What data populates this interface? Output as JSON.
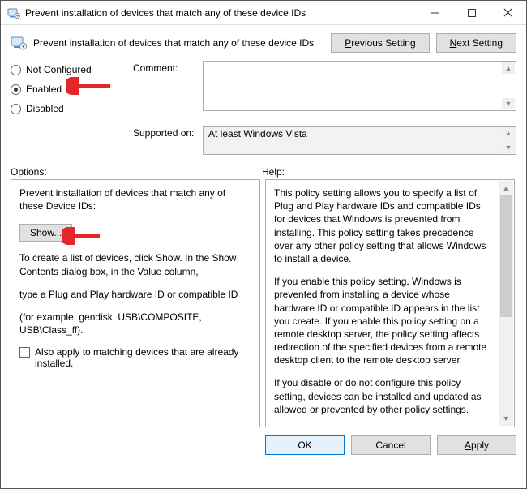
{
  "window": {
    "title": "Prevent installation of devices that match any of these device IDs"
  },
  "header": {
    "title": "Prevent installation of devices that match any of these device IDs",
    "prev_button": "Previous Setting",
    "next_button": "Next Setting"
  },
  "radios": {
    "not_configured": "Not Configured",
    "enabled": "Enabled",
    "disabled": "Disabled",
    "selected": "enabled"
  },
  "labels": {
    "comment": "Comment:",
    "supported_on": "Supported on:",
    "options": "Options:",
    "help": "Help:"
  },
  "comment_value": "",
  "supported_on_value": "At least Windows Vista",
  "options_panel": {
    "heading": "Prevent installation of devices that match any of these Device IDs:",
    "show_button": "Show...",
    "line1": "To create a list of devices, click Show. In the Show Contents dialog box, in the Value column,",
    "line2": "type a Plug and Play hardware ID or compatible ID",
    "line3": "(for example, gendisk, USB\\COMPOSITE, USB\\Class_ff).",
    "checkbox_label": "Also apply to matching devices that are already installed."
  },
  "help_panel": {
    "p1": "This policy setting allows you to specify a list of Plug and Play hardware IDs and compatible IDs for devices that Windows is prevented from installing. This policy setting takes precedence over any other policy setting that allows Windows to install a device.",
    "p2": "If you enable this policy setting, Windows is prevented from installing a device whose hardware ID or compatible ID appears in the list you create. If you enable this policy setting on a remote desktop server, the policy setting affects redirection of the specified devices from a remote desktop client to the remote desktop server.",
    "p3": "If you disable or do not configure this policy setting, devices can be installed and updated as allowed or prevented by other policy settings."
  },
  "footer": {
    "ok": "OK",
    "cancel": "Cancel",
    "apply": "Apply"
  }
}
